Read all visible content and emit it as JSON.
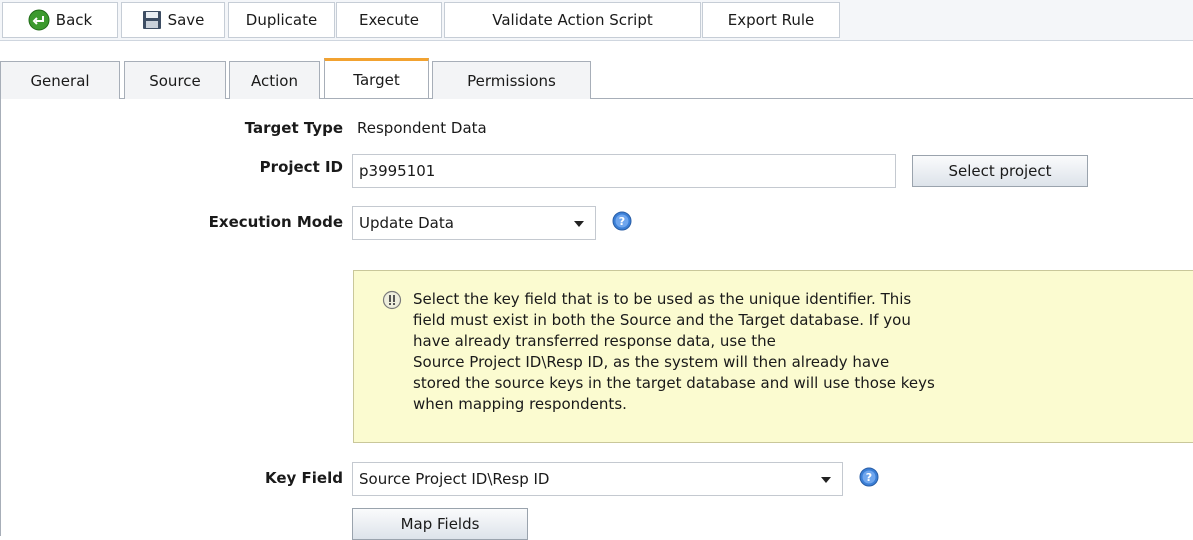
{
  "toolbar": {
    "back_label": "Back",
    "save_label": "Save",
    "duplicate_label": "Duplicate",
    "execute_label": "Execute",
    "validate_label": "Validate Action Script",
    "export_label": "Export Rule"
  },
  "tabs": [
    {
      "label": "General"
    },
    {
      "label": "Source"
    },
    {
      "label": "Action"
    },
    {
      "label": "Target"
    },
    {
      "label": "Permissions"
    }
  ],
  "active_tab": "Target",
  "form": {
    "target_type_label": "Target Type",
    "target_type_value": "Respondent Data",
    "project_id_label": "Project ID",
    "project_id_value": "p3995101",
    "select_project_label": "Select project",
    "execution_mode_label": "Execution Mode",
    "execution_mode_value": "Update Data",
    "info_lines": [
      "Select the key field that is to be used as the unique identifier. This",
      "field must exist in both the Source and the Target database. If you",
      "have already transferred response data, use the",
      "Source Project ID\\Resp ID, as the system will then already have",
      "stored the source keys in the target database and will use those keys",
      "when mapping respondents."
    ],
    "key_field_label": "Key Field",
    "key_field_value": "Source Project ID\\Resp ID",
    "map_fields_label": "Map Fields"
  },
  "icons": {
    "back": "back-arrow-icon",
    "save": "floppy-disk-icon",
    "help": "help-icon",
    "info": "info-icon"
  },
  "colors": {
    "active_tab_accent": "#f2a230",
    "info_background": "#fbfbd0",
    "back_icon": "#3c9a2e",
    "help_icon": "#3b7fd6"
  }
}
